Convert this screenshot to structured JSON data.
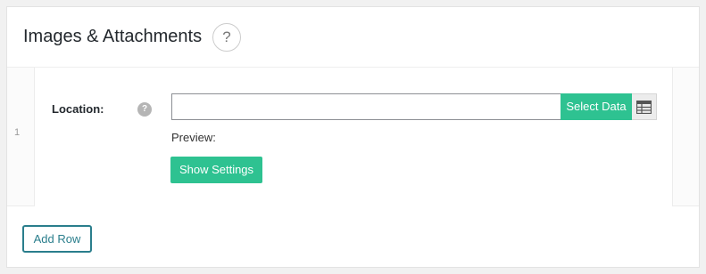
{
  "header": {
    "title": "Images & Attachments",
    "help_icon": "question-circle-icon",
    "help_glyph": "?"
  },
  "row": {
    "number": "1",
    "location_label": "Location:",
    "help_glyph": "?",
    "location_value": "",
    "location_placeholder": "",
    "select_data_label": "Select Data",
    "table_icon": "table-icon",
    "preview_label": "Preview:",
    "show_settings_label": "Show Settings"
  },
  "footer": {
    "add_row_label": "Add Row"
  },
  "colors": {
    "accent_green": "#2ec291",
    "accent_teal": "#2a7e8c"
  }
}
